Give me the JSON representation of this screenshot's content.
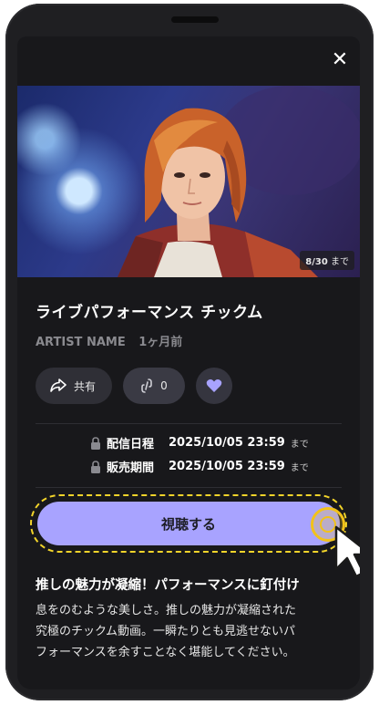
{
  "hero": {
    "badge_count": "8/30",
    "badge_suffix": "まで"
  },
  "content": {
    "title": "ライブパフォーマンス チックム",
    "artist": "ARTIST NAME",
    "time_ago": "1ヶ月前"
  },
  "actions": {
    "share_label": "共有",
    "link_count": "0"
  },
  "info": {
    "delivery_label": "配信日程",
    "delivery_date": "2025/10/05 23:59",
    "delivery_suffix": "まで",
    "sales_label": "販売期間",
    "sales_date": "2025/10/05 23:59",
    "sales_suffix": "まで"
  },
  "cta": {
    "label": "視聴する"
  },
  "description": {
    "heading": "推しの魅力が凝縮！パフォーマンスに釘付け",
    "lines": [
      "息をのむような美しさ。推しの魅力が凝縮された",
      "究極のチックム動画。一瞬たりとも見逃せないパ",
      "フォーマンスを余すことなく堪能してください。"
    ]
  },
  "colors": {
    "background": "#18181b",
    "accent": "#a8a3ff",
    "highlight": "#f2d42a",
    "heart": "#a8a3ff"
  },
  "icons": [
    "close-icon",
    "share-icon",
    "link-icon",
    "heart-icon",
    "lock-icon",
    "cursor-icon"
  ]
}
